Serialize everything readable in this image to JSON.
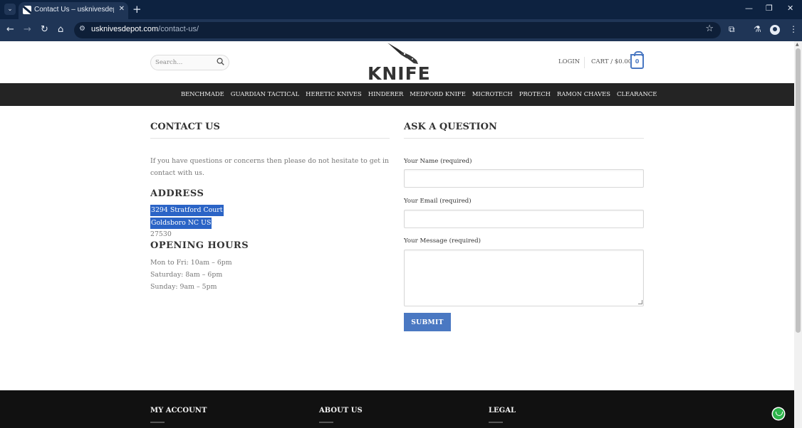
{
  "browser": {
    "tab_title": "Contact Us – usknivesdepot.com",
    "url_domain": "usknivesdepot.com",
    "url_path": "/contact-us/"
  },
  "header": {
    "search_placeholder": "Search...",
    "logo_text": "KNIFE",
    "login": "LOGIN",
    "cart_label": "CART / $0.00",
    "cart_count": "0"
  },
  "nav": {
    "items": [
      "BENCHMADE",
      "GUARDIAN TACTICAL",
      "HERETIC KNIVES",
      "HINDERER",
      "MEDFORD KNIFE",
      "MICROTECH",
      "PROTECH",
      "RAMON CHAVES",
      "CLEARANCE"
    ]
  },
  "contact": {
    "heading": "CONTACT US",
    "intro": "If you have questions or concerns then please do not hesitate to get in contact with us.",
    "address_heading": "ADDRESS",
    "address_line1": "3294 Stratford Court",
    "address_line2": "Goldsboro NC US",
    "address_line3": "27530",
    "hours_heading": "OPENING HOURS",
    "hours": [
      "Mon to Fri: 10am – 6pm",
      "Saturday: 8am – 6pm",
      "Sunday: 9am – 5pm"
    ]
  },
  "form": {
    "heading": "ASK A QUESTION",
    "name_label": "Your Name (required)",
    "email_label": "Your Email (required)",
    "message_label": "Your Message (required)",
    "submit": "SUBMIT"
  },
  "footer": {
    "col1": "MY ACCOUNT",
    "col2": "ABOUT US",
    "col3": "LEGAL"
  },
  "colors": {
    "accent": "#4a78c2",
    "nav_bg": "#242424",
    "selection": "#2b64c6",
    "footer_bg": "#111111"
  }
}
